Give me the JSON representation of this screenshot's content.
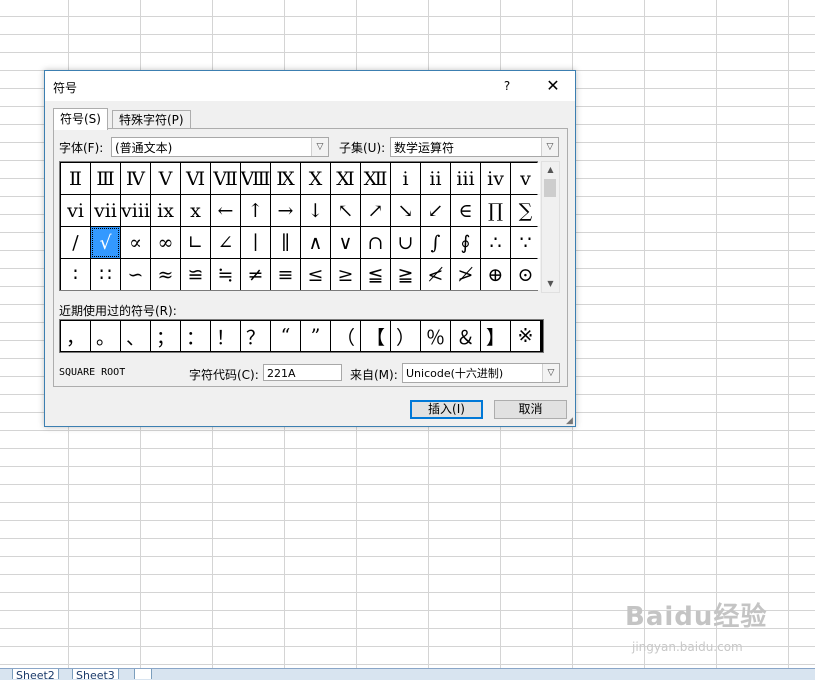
{
  "dialog": {
    "title": "符号",
    "help": "?",
    "close": "✕",
    "tabs": [
      "符号(S)",
      "特殊字符(P)"
    ],
    "font_label": "字体(F):",
    "font_value": "(普通文本)",
    "subset_label": "子集(U):",
    "subset_value": "数学运算符",
    "recent_label": "近期使用过的符号(R):",
    "char_name": "SQUARE ROOT",
    "code_label": "字符代码(C):",
    "code_value": "221A",
    "from_label": "来自(M):",
    "from_value": "Unicode(十六进制)",
    "insert_button": "插入(I)",
    "cancel_button": "取消",
    "dropdown_arrow": "▽"
  },
  "symbols": [
    [
      "Ⅱ",
      "Ⅲ",
      "Ⅳ",
      "Ⅴ",
      "Ⅵ",
      "Ⅶ",
      "Ⅷ",
      "Ⅸ",
      "Ⅹ",
      "Ⅺ",
      "Ⅻ",
      "ⅰ",
      "ⅱ",
      "ⅲ",
      "ⅳ",
      "ⅴ"
    ],
    [
      "ⅵ",
      "ⅶ",
      "ⅷ",
      "ⅸ",
      "ⅹ",
      "←",
      "↑",
      "→",
      "↓",
      "↖",
      "↗",
      "↘",
      "↙",
      "∈",
      "∏",
      "∑"
    ],
    [
      "∕",
      "√",
      "∝",
      "∞",
      "∟",
      "∠",
      "∣",
      "∥",
      "∧",
      "∨",
      "∩",
      "∪",
      "∫",
      "∮",
      "∴",
      "∵"
    ],
    [
      "∶",
      "∷",
      "∽",
      "≈",
      "≌",
      "≒",
      "≠",
      "≡",
      "≤",
      "≥",
      "≦",
      "≧",
      "≮",
      "≯",
      "⊕",
      "⊙"
    ]
  ],
  "selected_symbol": "√",
  "recent_symbols": [
    "，",
    "。",
    "、",
    "；",
    "：",
    "！",
    "？",
    "“",
    "”",
    "（",
    "【",
    "）",
    "％",
    "＆",
    "】",
    "※"
  ],
  "sheet_tabs": [
    "Sheet2",
    "Sheet3"
  ],
  "watermark": {
    "main": "Baidu经验",
    "sub": "jingyan.baidu.com"
  }
}
